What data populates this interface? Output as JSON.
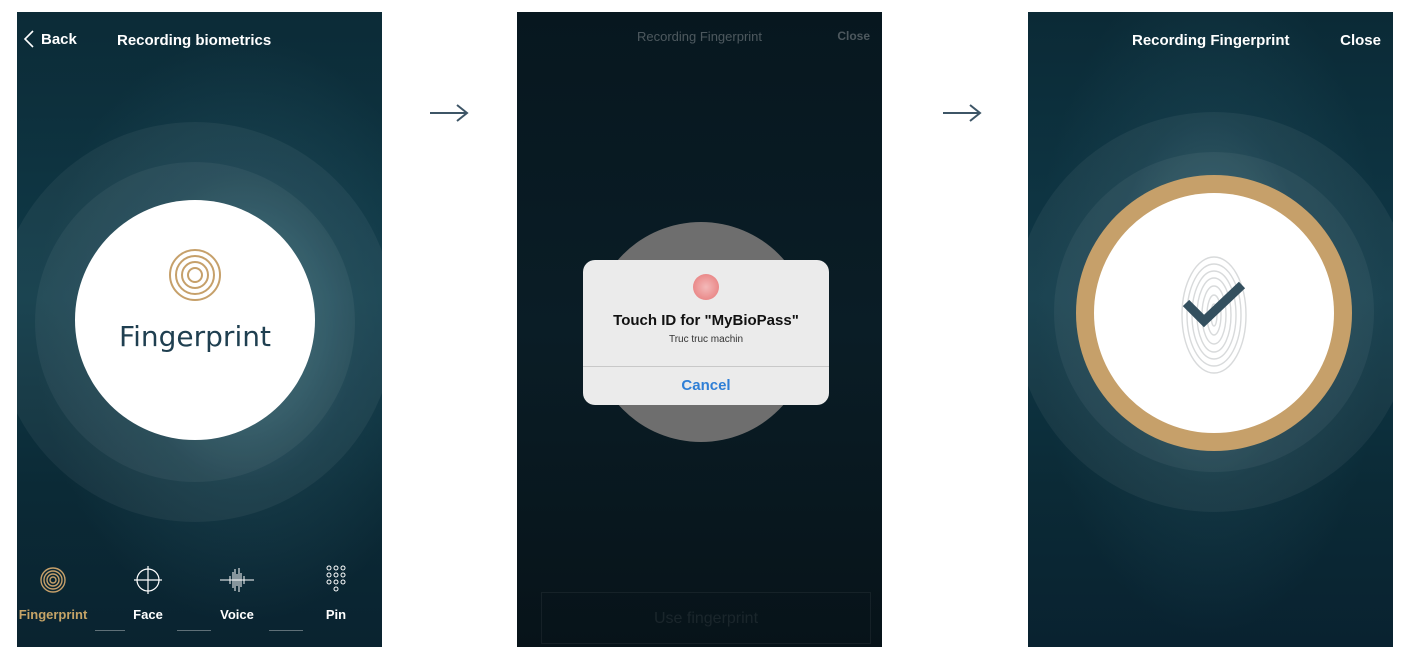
{
  "screen1": {
    "back_label": "Back",
    "title": "Recording biometrics",
    "circle_label": "Fingerprint",
    "tabs": [
      {
        "label": "Fingerprint",
        "icon": "fingerprint-rings-icon",
        "active": true
      },
      {
        "label": "Face",
        "icon": "face-crosshair-icon",
        "active": false
      },
      {
        "label": "Voice",
        "icon": "voice-waveform-icon",
        "active": false
      },
      {
        "label": "Pin",
        "icon": "pin-keypad-icon",
        "active": false
      }
    ]
  },
  "screen2": {
    "title": "Recording Fingerprint",
    "close_label": "Close",
    "alert": {
      "title": "Touch ID for \"MyBioPass\"",
      "subtitle": "Truc truc machin",
      "cancel_label": "Cancel",
      "icon": "touch-id-icon"
    },
    "bottom_button_label": "Use fingerprint"
  },
  "screen3": {
    "title": "Recording Fingerprint",
    "close_label": "Close",
    "status_icon": "checkmark-icon"
  },
  "colors": {
    "accent_gold": "#c6a06a",
    "dark_teal": "#0c2b37",
    "ios_blue": "#2f7fd6",
    "label_navy": "#1f3f50"
  }
}
